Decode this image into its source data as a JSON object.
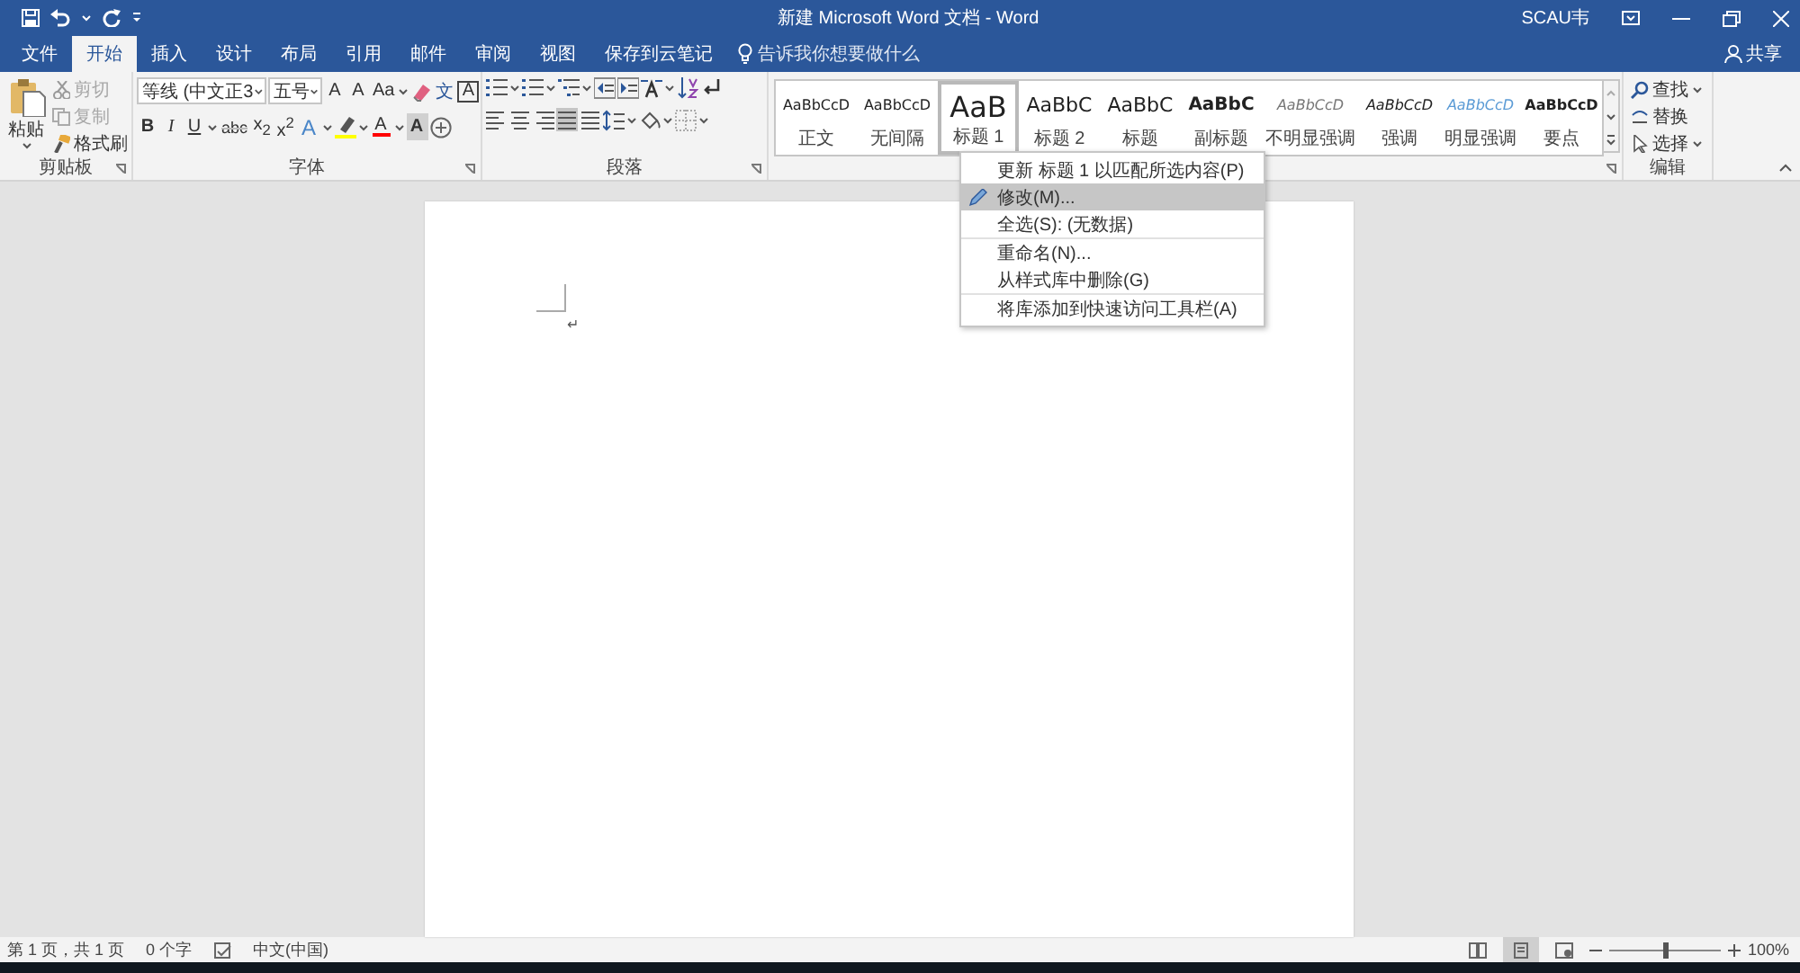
{
  "title_bar": {
    "title": "新建 Microsoft Word 文档 - Word",
    "user": "SCAU韦"
  },
  "tabs": [
    {
      "label": "文件",
      "selected": false
    },
    {
      "label": "开始",
      "selected": true
    },
    {
      "label": "插入",
      "selected": false
    },
    {
      "label": "设计",
      "selected": false
    },
    {
      "label": "布局",
      "selected": false
    },
    {
      "label": "引用",
      "selected": false
    },
    {
      "label": "邮件",
      "selected": false
    },
    {
      "label": "审阅",
      "selected": false
    },
    {
      "label": "视图",
      "selected": false
    },
    {
      "label": "保存到云笔记",
      "selected": false
    }
  ],
  "tell_me": {
    "placeholder": "告诉我你想要做什么"
  },
  "share": "共享",
  "clipboard": {
    "label": "剪贴板",
    "paste": "粘贴",
    "items": [
      {
        "kind": "cut",
        "label": "剪切",
        "disabled": true
      },
      {
        "kind": "copy",
        "label": "复制",
        "disabled": true
      },
      {
        "kind": "painter",
        "label": "格式刷",
        "disabled": false
      }
    ]
  },
  "font": {
    "label": "字体",
    "font_name": "等线 (中文正3",
    "font_size": "五号",
    "row1": [
      {
        "kind": "grow",
        "label": "A"
      },
      {
        "kind": "shrink",
        "label": "A"
      },
      {
        "kind": "case",
        "label": "Aa"
      },
      {
        "kind": "clear"
      },
      {
        "kind": "phonetic",
        "label": "文"
      },
      {
        "kind": "border",
        "label": "A"
      }
    ],
    "row2": [
      {
        "kind": "bold",
        "label": "B"
      },
      {
        "kind": "italic",
        "label": "I"
      },
      {
        "kind": "underline",
        "label": "U"
      },
      {
        "kind": "strike",
        "label": "abc"
      },
      {
        "kind": "sub",
        "label": "x$_{2}$"
      },
      {
        "kind": "sup",
        "label": "x$^{2}$"
      },
      {
        "kind": "effect",
        "label": "A"
      },
      {
        "kind": "highlight",
        "color": "#ffff00"
      },
      {
        "kind": "color",
        "label": "A",
        "color": "#ff0000"
      },
      {
        "kind": "shade",
        "label": "A"
      },
      {
        "kind": "enclose"
      }
    ]
  },
  "paragraph": {
    "label": "段落",
    "align": [
      {
        "kind": "left",
        "selected": false
      },
      {
        "kind": "center",
        "selected": false
      },
      {
        "kind": "right",
        "selected": false
      },
      {
        "kind": "justify",
        "selected": true
      },
      {
        "kind": "distributed",
        "selected": false
      }
    ]
  },
  "styles": {
    "items": [
      {
        "preview": "AaBbCcD",
        "name": "正文",
        "kind": "normal",
        "selected": false
      },
      {
        "preview": "AaBbCcD",
        "name": "无间隔",
        "kind": "normal",
        "selected": false
      },
      {
        "preview": "AaB",
        "name": "标题 1",
        "kind": "h1",
        "selected": true
      },
      {
        "preview": "AaBbC",
        "name": "标题 2",
        "kind": "h2",
        "selected": false
      },
      {
        "preview": "AaBbC",
        "name": "标题",
        "kind": "title",
        "selected": false
      },
      {
        "preview": "AaBbC",
        "name": "副标题",
        "kind": "subtitle",
        "selected": false
      },
      {
        "preview": "AaBbCcD",
        "name": "不明显强调",
        "kind": "subtle",
        "selected": false
      },
      {
        "preview": "AaBbCcD",
        "name": "强调",
        "kind": "emphasis",
        "selected": false
      },
      {
        "preview": "AaBbCcD",
        "name": "明显强调",
        "kind": "intense",
        "selected": false
      },
      {
        "preview": "AaBbCcD",
        "name": "要点",
        "kind": "strong",
        "selected": false
      }
    ]
  },
  "editing": {
    "label": "编辑",
    "items": [
      {
        "kind": "find",
        "label": "查找"
      },
      {
        "kind": "replace",
        "label": "替换"
      },
      {
        "kind": "select",
        "label": "选择"
      }
    ]
  },
  "context_menu": [
    {
      "label": "更新 标题 1 以匹配所选内容(P)",
      "highlighted": false,
      "has_icon": false,
      "separator_after": false
    },
    {
      "label": "修改(M)...",
      "highlighted": true,
      "has_icon": true,
      "separator_after": false
    },
    {
      "label": "全选(S): (无数据)",
      "highlighted": false,
      "has_icon": false,
      "separator_after": true
    },
    {
      "label": "重命名(N)...",
      "highlighted": false,
      "has_icon": false,
      "separator_after": false
    },
    {
      "label": "从样式库中删除(G)",
      "highlighted": false,
      "has_icon": false,
      "separator_after": true
    },
    {
      "label": "将库添加到快速访问工具栏(A)",
      "highlighted": false,
      "has_icon": false,
      "separator_after": false
    }
  ],
  "document": {
    "paragraph_mark": "↵"
  },
  "status_bar": {
    "page": "第 1 页，共 1 页",
    "words": "0 个字",
    "language": "中文(中国)",
    "zoom": "100%",
    "zoom_slider": {
      "level": 0.5
    },
    "views": [
      {
        "kind": "read",
        "selected": false
      },
      {
        "kind": "print",
        "selected": true
      },
      {
        "kind": "web",
        "selected": false
      }
    ]
  }
}
